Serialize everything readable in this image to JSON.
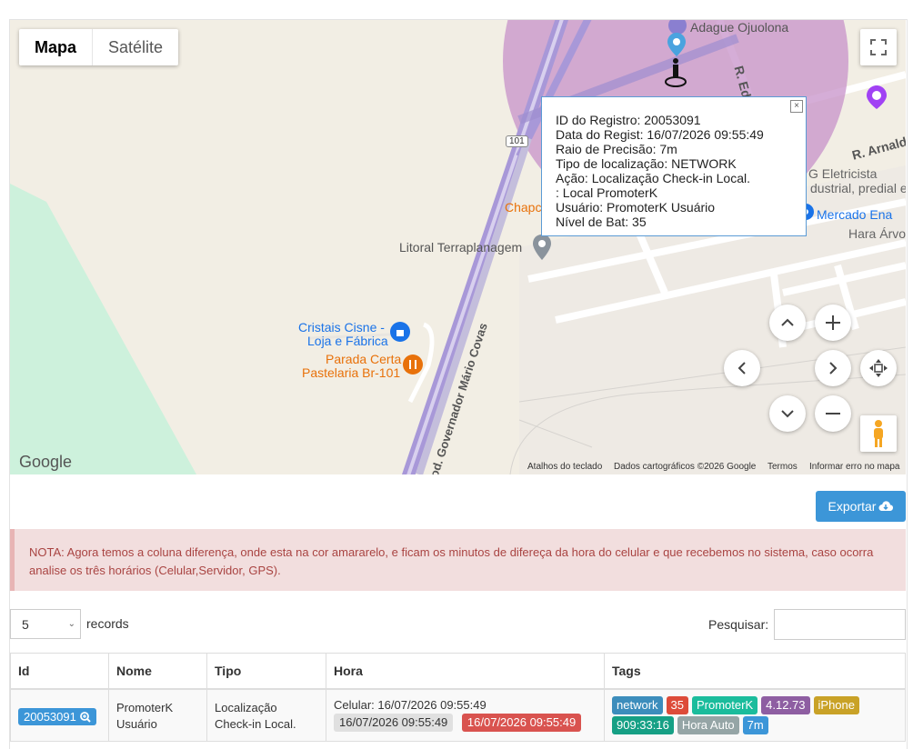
{
  "map": {
    "maptype": {
      "map_label": "Mapa",
      "satellite_label": "Satélite"
    },
    "labels": {
      "adague": "Adague Ojuolona",
      "r_ed": "R. Ed",
      "r_arnaldo": "R. Arnaldo",
      "eletricista_1": "G Eletricista",
      "eletricista_2": "dustrial, predial e",
      "mercado": "Mercado Ena",
      "hora_arvor": "Hara Árvor",
      "chapc": "Chapc",
      "litoral": "Litoral Terraplanagem",
      "route_101": "101",
      "cristais_1": "Cristais Cisne -",
      "cristais_2": "Loja e Fábrica",
      "parada_1": "Parada Certa",
      "parada_2": "Pastelaria Br-101",
      "road_name": "Rod. Governador Mário Covas"
    },
    "google_logo": "Google",
    "attribution": {
      "shortcuts": "Atalhos do teclado",
      "data": "Dados cartográficos ©2026 Google",
      "terms": "Termos",
      "report": "Informar erro no mapa"
    },
    "infowindow": {
      "lines": [
        "ID do Registro: 20053091",
        "Data do Regist: 16/07/2026 09:55:49",
        "Raio de Precisão: 7m",
        "Tipo de localização: NETWORK",
        "Ação: Localização Check-in Local.",
        ": Local PromoterK",
        "Usuário: PromoterK Usuário",
        "Nível de Bat: 35"
      ],
      "close": "×"
    },
    "colors": {
      "accuracy_circle": "#c792c9",
      "land": "#f2eee4",
      "green": "#cdf1dc",
      "road": "#ffffff",
      "highway": "#9f8fd0"
    }
  },
  "toolbar": {
    "export_label": "Exportar"
  },
  "note": "NOTA: Agora temos a coluna diferença, onde esta na cor amararelo, e ficam os minutos de difereça da hora do celular e que recebemos no sistema, caso ocorra analise os três horários (Celular,Servidor, GPS).",
  "table_controls": {
    "page_length": "5",
    "records_label": "records",
    "search_label": "Pesquisar:"
  },
  "table": {
    "columns": [
      "Id",
      "Nome",
      "Tipo",
      "Hora",
      "Tags"
    ],
    "rows": [
      {
        "id": "20053091",
        "nome_1": "PromoterK",
        "nome_2": "Usuário",
        "tipo_1": "Localização",
        "tipo_2": "Check-in Local.",
        "hora_celular": "Celular: 16/07/2026 09:55:49",
        "hora_servidor": "16/07/2026 09:55:49",
        "hora_gps": "16/07/2026 09:55:49",
        "tags": [
          {
            "text": "network",
            "color": "#3c8dbc"
          },
          {
            "text": "35",
            "color": "#dd4b39"
          },
          {
            "text": "PromoterK",
            "color": "#1abc9c"
          },
          {
            "text": "4.12.73",
            "color": "#8e5ea2"
          },
          {
            "text": "iPhone",
            "color": "#c9a227"
          },
          {
            "text": "909:33:16",
            "color": "#16a085"
          },
          {
            "text": "Hora Auto",
            "color": "#95a5a6"
          },
          {
            "text": "7m",
            "color": "#3c96d8"
          }
        ]
      }
    ]
  }
}
